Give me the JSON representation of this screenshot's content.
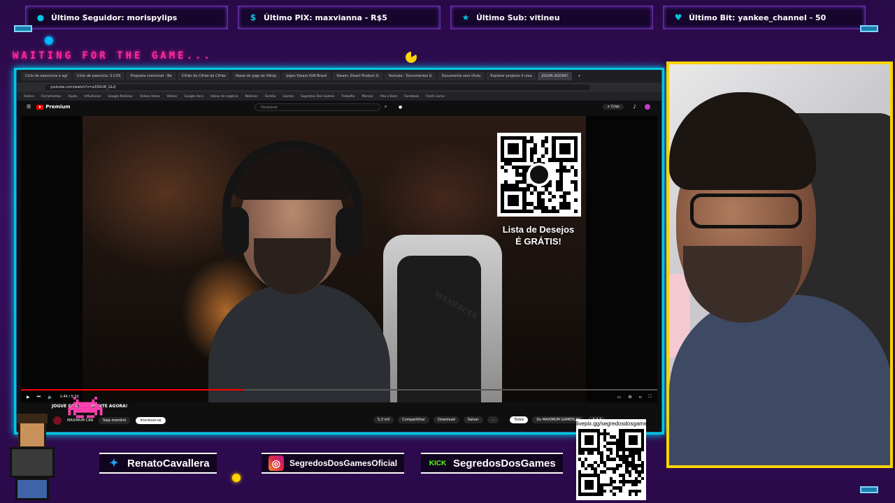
{
  "alerts": [
    {
      "icon": "user-icon",
      "label": "Último Seguidor: morispylips",
      "color": "#00c7e0"
    },
    {
      "icon": "dollar-icon",
      "label": "Último PIX: maxvianna - R$5",
      "color": "#00c7e0"
    },
    {
      "icon": "star-icon",
      "label": "Último Sub: vitineu",
      "color": "#00c7e0"
    },
    {
      "icon": "heart-icon",
      "label": "Último Bit: yankee_channel - 50",
      "color": "#00c7e0"
    }
  ],
  "overlay": {
    "waiting_text": "WAITING FOR THE GAME...",
    "wishlist_line1": "Lista de Desejos",
    "wishlist_line2": "É GRÁTIS!",
    "pix_url": "livepix.gg/segredosdosgames"
  },
  "browser": {
    "tabs": [
      "Ciclo de exercícios e agi",
      "Ciclo de exercício: S.COS",
      "Proposta comercial - Be",
      "Cifrão de Cifrão do Cifrão",
      "Passe do jogo do Olimp",
      "Jogos Steam IGM Brasil",
      "Steam: Direct Product G",
      "Youtube : Documentos G",
      "Documento sem título",
      "Explorer projetos li crea",
      "JOGAR AGORA!",
      "+"
    ],
    "url": "youtube.com/watch?v=a3S0iUR_GLQ",
    "bookmarks": [
      "Outros",
      "Ferramentas",
      "Ajuda",
      "Influências",
      "Google Notícias",
      "Vídeos Ideas",
      "Vídeos",
      "Google docs",
      "Ideias de negócio",
      "Notícias",
      "Família",
      "Games",
      "Segredos Dos Games",
      "Trabalho",
      "Marcas",
      "Alto e Bom",
      "Facebook",
      "Fresh Livros",
      "Marco Feliciano",
      "Vídeos"
    ]
  },
  "youtube": {
    "logo_text": "Premium",
    "search_placeholder": "Pesquisar",
    "create_label": "Criar",
    "video_title": "JOGUE GRATUITAMENTE AGORA!",
    "channel_name": "MAXIMUM CAN",
    "join_label": "Seja membro",
    "subscribe_label": "Inscrever-se",
    "likes_label": "5,3 mil",
    "share_label": "Compartilhar",
    "download_label": "Download",
    "save_label": "Salvar",
    "more_label": "...",
    "chip_all": "Todos",
    "chip_channel": "Do MAXIMUM GAMEPLAY",
    "chip_related": "A 3 A",
    "progress_percent": 35,
    "time_label": "1:44 / 5:32",
    "chair_brand": "MAXRACER"
  },
  "socials": [
    {
      "icon": "twitter-icon",
      "handle": "RenatoCavallera",
      "icon_color": "#1da1f2",
      "glyph": "🐦"
    },
    {
      "icon": "instagram-icon",
      "handle": "SegredosDosGamesOficial",
      "icon_color": "#d6249f",
      "glyph": "◎"
    },
    {
      "icon": "kick-icon",
      "handle": "SegredosDosGames",
      "icon_color": "#53fc18",
      "glyph": "KICK"
    }
  ],
  "colors": {
    "neon_cyan": "#00c7e0",
    "neon_pink": "#ff2a9a",
    "webcam_border": "#f5d400",
    "youtube_red": "#ff0000"
  }
}
